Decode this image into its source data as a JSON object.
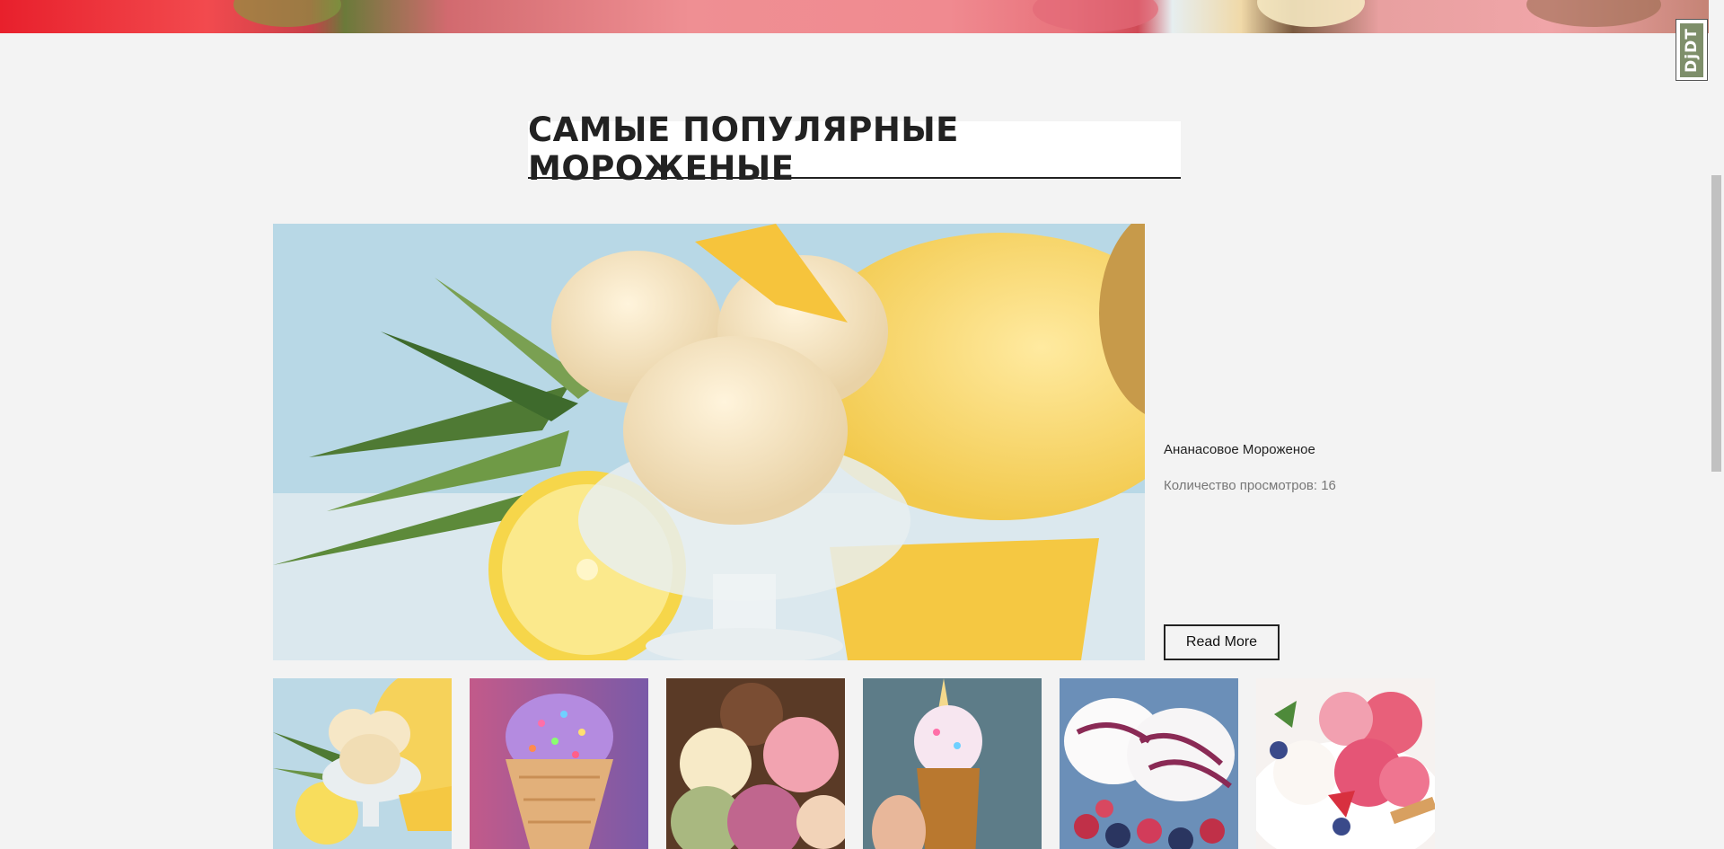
{
  "section": {
    "title": "САМЫЕ ПОПУЛЯРНЫЕ МОРОЖЕНЫЕ"
  },
  "featured": {
    "name": "Ананасовое Мороженое",
    "views_label": "Количество просмотров:",
    "views_count": "16",
    "read_more_label": "Read More"
  },
  "thumbnails": [
    {
      "name": "pineapple-ice-cream"
    },
    {
      "name": "sprinkles-cone"
    },
    {
      "name": "assorted-scoops"
    },
    {
      "name": "unicorn-taiyaki-cone"
    },
    {
      "name": "berry-ice-cream"
    },
    {
      "name": "strawberry-ice-cream-plate"
    }
  ],
  "debug_toolbar": {
    "label": "DjDT"
  },
  "colors": {
    "background": "#f3f3f3",
    "title_text": "#222222",
    "muted_text": "#777777"
  }
}
